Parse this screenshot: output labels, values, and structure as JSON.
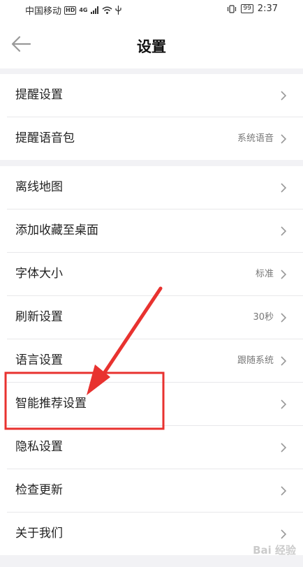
{
  "status_bar": {
    "carrier": "中国移动",
    "hd": "HD",
    "network": "4G",
    "battery": "99",
    "time": "2:37"
  },
  "header": {
    "title": "设置"
  },
  "groups": [
    {
      "items": [
        {
          "label": "提醒设置",
          "value": ""
        },
        {
          "label": "提醒语音包",
          "value": "系统语音"
        }
      ]
    },
    {
      "items": [
        {
          "label": "离线地图",
          "value": ""
        },
        {
          "label": "添加收藏至桌面",
          "value": ""
        },
        {
          "label": "字体大小",
          "value": "标准"
        },
        {
          "label": "刷新设置",
          "value": "30秒"
        },
        {
          "label": "语言设置",
          "value": "跟随系统"
        },
        {
          "label": "智能推荐设置",
          "value": ""
        },
        {
          "label": "隐私设置",
          "value": ""
        },
        {
          "label": "检查更新",
          "value": ""
        },
        {
          "label": "关于我们",
          "value": ""
        }
      ]
    }
  ],
  "watermark": "Bai 经验",
  "colors": {
    "annotation": "#e8322f",
    "background": "#f2f2f5"
  }
}
